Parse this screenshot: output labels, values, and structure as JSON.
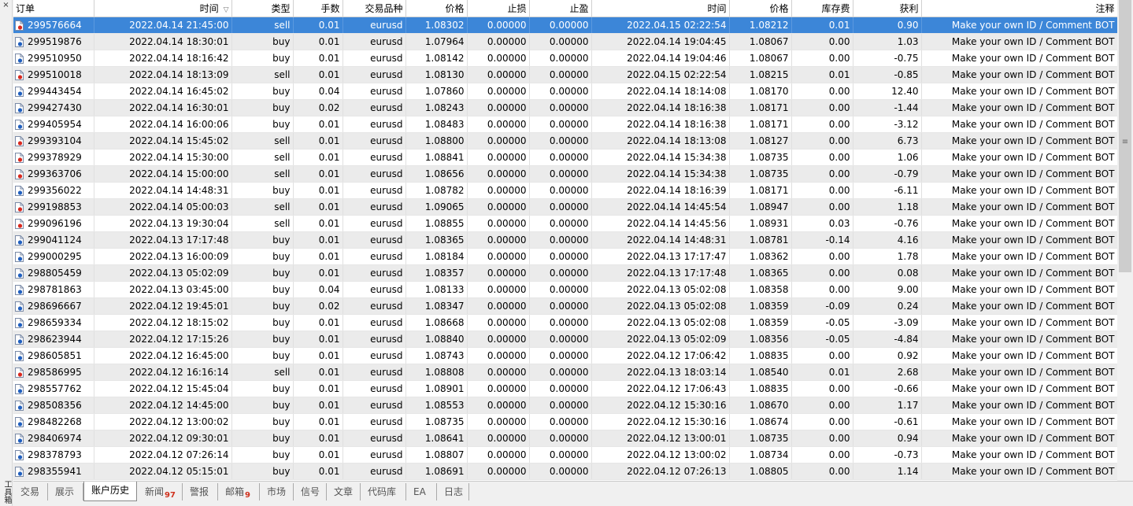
{
  "window": {
    "title": "工具箱",
    "close_label": "×"
  },
  "columns": [
    "订单",
    "时间",
    "类型",
    "手数",
    "交易品种",
    "价格",
    "止损",
    "止盈",
    "时间",
    "价格",
    "库存费",
    "获利",
    "注释"
  ],
  "sort_indicator": "▽",
  "rows": [
    {
      "id": "299576664",
      "open_time": "2022.04.14 21:45:00",
      "type": "sell",
      "lots": "0.01",
      "symbol": "eurusd",
      "open_price": "1.08302",
      "sl": "0.00000",
      "tp": "0.00000",
      "close_time": "2022.04.15 02:22:54",
      "close_price": "1.08212",
      "swap": "0.01",
      "profit": "0.90",
      "comment": "Make your own ID / Comment BOT"
    },
    {
      "id": "299519876",
      "open_time": "2022.04.14 18:30:01",
      "type": "buy",
      "lots": "0.01",
      "symbol": "eurusd",
      "open_price": "1.07964",
      "sl": "0.00000",
      "tp": "0.00000",
      "close_time": "2022.04.14 19:04:45",
      "close_price": "1.08067",
      "swap": "0.00",
      "profit": "1.03",
      "comment": "Make your own ID / Comment BOT"
    },
    {
      "id": "299510950",
      "open_time": "2022.04.14 18:16:42",
      "type": "buy",
      "lots": "0.01",
      "symbol": "eurusd",
      "open_price": "1.08142",
      "sl": "0.00000",
      "tp": "0.00000",
      "close_time": "2022.04.14 19:04:46",
      "close_price": "1.08067",
      "swap": "0.00",
      "profit": "-0.75",
      "comment": "Make your own ID / Comment BOT"
    },
    {
      "id": "299510018",
      "open_time": "2022.04.14 18:13:09",
      "type": "sell",
      "lots": "0.01",
      "symbol": "eurusd",
      "open_price": "1.08130",
      "sl": "0.00000",
      "tp": "0.00000",
      "close_time": "2022.04.15 02:22:54",
      "close_price": "1.08215",
      "swap": "0.01",
      "profit": "-0.85",
      "comment": "Make your own ID / Comment BOT"
    },
    {
      "id": "299443454",
      "open_time": "2022.04.14 16:45:02",
      "type": "buy",
      "lots": "0.04",
      "symbol": "eurusd",
      "open_price": "1.07860",
      "sl": "0.00000",
      "tp": "0.00000",
      "close_time": "2022.04.14 18:14:08",
      "close_price": "1.08170",
      "swap": "0.00",
      "profit": "12.40",
      "comment": "Make your own ID / Comment BOT"
    },
    {
      "id": "299427430",
      "open_time": "2022.04.14 16:30:01",
      "type": "buy",
      "lots": "0.02",
      "symbol": "eurusd",
      "open_price": "1.08243",
      "sl": "0.00000",
      "tp": "0.00000",
      "close_time": "2022.04.14 18:16:38",
      "close_price": "1.08171",
      "swap": "0.00",
      "profit": "-1.44",
      "comment": "Make your own ID / Comment BOT"
    },
    {
      "id": "299405954",
      "open_time": "2022.04.14 16:00:06",
      "type": "buy",
      "lots": "0.01",
      "symbol": "eurusd",
      "open_price": "1.08483",
      "sl": "0.00000",
      "tp": "0.00000",
      "close_time": "2022.04.14 18:16:38",
      "close_price": "1.08171",
      "swap": "0.00",
      "profit": "-3.12",
      "comment": "Make your own ID / Comment BOT"
    },
    {
      "id": "299393104",
      "open_time": "2022.04.14 15:45:02",
      "type": "sell",
      "lots": "0.01",
      "symbol": "eurusd",
      "open_price": "1.08800",
      "sl": "0.00000",
      "tp": "0.00000",
      "close_time": "2022.04.14 18:13:08",
      "close_price": "1.08127",
      "swap": "0.00",
      "profit": "6.73",
      "comment": "Make your own ID / Comment BOT"
    },
    {
      "id": "299378929",
      "open_time": "2022.04.14 15:30:00",
      "type": "sell",
      "lots": "0.01",
      "symbol": "eurusd",
      "open_price": "1.08841",
      "sl": "0.00000",
      "tp": "0.00000",
      "close_time": "2022.04.14 15:34:38",
      "close_price": "1.08735",
      "swap": "0.00",
      "profit": "1.06",
      "comment": "Make your own ID / Comment BOT"
    },
    {
      "id": "299363706",
      "open_time": "2022.04.14 15:00:00",
      "type": "sell",
      "lots": "0.01",
      "symbol": "eurusd",
      "open_price": "1.08656",
      "sl": "0.00000",
      "tp": "0.00000",
      "close_time": "2022.04.14 15:34:38",
      "close_price": "1.08735",
      "swap": "0.00",
      "profit": "-0.79",
      "comment": "Make your own ID / Comment BOT"
    },
    {
      "id": "299356022",
      "open_time": "2022.04.14 14:48:31",
      "type": "buy",
      "lots": "0.01",
      "symbol": "eurusd",
      "open_price": "1.08782",
      "sl": "0.00000",
      "tp": "0.00000",
      "close_time": "2022.04.14 18:16:39",
      "close_price": "1.08171",
      "swap": "0.00",
      "profit": "-6.11",
      "comment": "Make your own ID / Comment BOT"
    },
    {
      "id": "299198853",
      "open_time": "2022.04.14 05:00:03",
      "type": "sell",
      "lots": "0.01",
      "symbol": "eurusd",
      "open_price": "1.09065",
      "sl": "0.00000",
      "tp": "0.00000",
      "close_time": "2022.04.14 14:45:54",
      "close_price": "1.08947",
      "swap": "0.00",
      "profit": "1.18",
      "comment": "Make your own ID / Comment BOT"
    },
    {
      "id": "299096196",
      "open_time": "2022.04.13 19:30:04",
      "type": "sell",
      "lots": "0.01",
      "symbol": "eurusd",
      "open_price": "1.08855",
      "sl": "0.00000",
      "tp": "0.00000",
      "close_time": "2022.04.14 14:45:56",
      "close_price": "1.08931",
      "swap": "0.03",
      "profit": "-0.76",
      "comment": "Make your own ID / Comment BOT"
    },
    {
      "id": "299041124",
      "open_time": "2022.04.13 17:17:48",
      "type": "buy",
      "lots": "0.01",
      "symbol": "eurusd",
      "open_price": "1.08365",
      "sl": "0.00000",
      "tp": "0.00000",
      "close_time": "2022.04.14 14:48:31",
      "close_price": "1.08781",
      "swap": "-0.14",
      "profit": "4.16",
      "comment": "Make your own ID / Comment BOT"
    },
    {
      "id": "299000295",
      "open_time": "2022.04.13 16:00:09",
      "type": "buy",
      "lots": "0.01",
      "symbol": "eurusd",
      "open_price": "1.08184",
      "sl": "0.00000",
      "tp": "0.00000",
      "close_time": "2022.04.13 17:17:47",
      "close_price": "1.08362",
      "swap": "0.00",
      "profit": "1.78",
      "comment": "Make your own ID / Comment BOT"
    },
    {
      "id": "298805459",
      "open_time": "2022.04.13 05:02:09",
      "type": "buy",
      "lots": "0.01",
      "symbol": "eurusd",
      "open_price": "1.08357",
      "sl": "0.00000",
      "tp": "0.00000",
      "close_time": "2022.04.13 17:17:48",
      "close_price": "1.08365",
      "swap": "0.00",
      "profit": "0.08",
      "comment": "Make your own ID / Comment BOT"
    },
    {
      "id": "298781863",
      "open_time": "2022.04.13 03:45:00",
      "type": "buy",
      "lots": "0.04",
      "symbol": "eurusd",
      "open_price": "1.08133",
      "sl": "0.00000",
      "tp": "0.00000",
      "close_time": "2022.04.13 05:02:08",
      "close_price": "1.08358",
      "swap": "0.00",
      "profit": "9.00",
      "comment": "Make your own ID / Comment BOT"
    },
    {
      "id": "298696667",
      "open_time": "2022.04.12 19:45:01",
      "type": "buy",
      "lots": "0.02",
      "symbol": "eurusd",
      "open_price": "1.08347",
      "sl": "0.00000",
      "tp": "0.00000",
      "close_time": "2022.04.13 05:02:08",
      "close_price": "1.08359",
      "swap": "-0.09",
      "profit": "0.24",
      "comment": "Make your own ID / Comment BOT"
    },
    {
      "id": "298659334",
      "open_time": "2022.04.12 18:15:02",
      "type": "buy",
      "lots": "0.01",
      "symbol": "eurusd",
      "open_price": "1.08668",
      "sl": "0.00000",
      "tp": "0.00000",
      "close_time": "2022.04.13 05:02:08",
      "close_price": "1.08359",
      "swap": "-0.05",
      "profit": "-3.09",
      "comment": "Make your own ID / Comment BOT"
    },
    {
      "id": "298623944",
      "open_time": "2022.04.12 17:15:26",
      "type": "buy",
      "lots": "0.01",
      "symbol": "eurusd",
      "open_price": "1.08840",
      "sl": "0.00000",
      "tp": "0.00000",
      "close_time": "2022.04.13 05:02:09",
      "close_price": "1.08356",
      "swap": "-0.05",
      "profit": "-4.84",
      "comment": "Make your own ID / Comment BOT"
    },
    {
      "id": "298605851",
      "open_time": "2022.04.12 16:45:00",
      "type": "buy",
      "lots": "0.01",
      "symbol": "eurusd",
      "open_price": "1.08743",
      "sl": "0.00000",
      "tp": "0.00000",
      "close_time": "2022.04.12 17:06:42",
      "close_price": "1.08835",
      "swap": "0.00",
      "profit": "0.92",
      "comment": "Make your own ID / Comment BOT"
    },
    {
      "id": "298586995",
      "open_time": "2022.04.12 16:16:14",
      "type": "sell",
      "lots": "0.01",
      "symbol": "eurusd",
      "open_price": "1.08808",
      "sl": "0.00000",
      "tp": "0.00000",
      "close_time": "2022.04.13 18:03:14",
      "close_price": "1.08540",
      "swap": "0.01",
      "profit": "2.68",
      "comment": "Make your own ID / Comment BOT"
    },
    {
      "id": "298557762",
      "open_time": "2022.04.12 15:45:04",
      "type": "buy",
      "lots": "0.01",
      "symbol": "eurusd",
      "open_price": "1.08901",
      "sl": "0.00000",
      "tp": "0.00000",
      "close_time": "2022.04.12 17:06:43",
      "close_price": "1.08835",
      "swap": "0.00",
      "profit": "-0.66",
      "comment": "Make your own ID / Comment BOT"
    },
    {
      "id": "298508356",
      "open_time": "2022.04.12 14:45:00",
      "type": "buy",
      "lots": "0.01",
      "symbol": "eurusd",
      "open_price": "1.08553",
      "sl": "0.00000",
      "tp": "0.00000",
      "close_time": "2022.04.12 15:30:16",
      "close_price": "1.08670",
      "swap": "0.00",
      "profit": "1.17",
      "comment": "Make your own ID / Comment BOT"
    },
    {
      "id": "298482268",
      "open_time": "2022.04.12 13:00:02",
      "type": "buy",
      "lots": "0.01",
      "symbol": "eurusd",
      "open_price": "1.08735",
      "sl": "0.00000",
      "tp": "0.00000",
      "close_time": "2022.04.12 15:30:16",
      "close_price": "1.08674",
      "swap": "0.00",
      "profit": "-0.61",
      "comment": "Make your own ID / Comment BOT"
    },
    {
      "id": "298406974",
      "open_time": "2022.04.12 09:30:01",
      "type": "buy",
      "lots": "0.01",
      "symbol": "eurusd",
      "open_price": "1.08641",
      "sl": "0.00000",
      "tp": "0.00000",
      "close_time": "2022.04.12 13:00:01",
      "close_price": "1.08735",
      "swap": "0.00",
      "profit": "0.94",
      "comment": "Make your own ID / Comment BOT"
    },
    {
      "id": "298378793",
      "open_time": "2022.04.12 07:26:14",
      "type": "buy",
      "lots": "0.01",
      "symbol": "eurusd",
      "open_price": "1.08807",
      "sl": "0.00000",
      "tp": "0.00000",
      "close_time": "2022.04.12 13:00:02",
      "close_price": "1.08734",
      "swap": "0.00",
      "profit": "-0.73",
      "comment": "Make your own ID / Comment BOT"
    },
    {
      "id": "298355941",
      "open_time": "2022.04.12 05:15:01",
      "type": "buy",
      "lots": "0.01",
      "symbol": "eurusd",
      "open_price": "1.08691",
      "sl": "0.00000",
      "tp": "0.00000",
      "close_time": "2022.04.12 07:26:13",
      "close_price": "1.08805",
      "swap": "0.00",
      "profit": "1.14",
      "comment": "Make your own ID / Comment BOT"
    }
  ],
  "scrollbar": {
    "grip": "≡"
  },
  "tabs": [
    {
      "label": "交易",
      "badge": ""
    },
    {
      "label": "展示",
      "badge": ""
    },
    {
      "label": "账户历史",
      "badge": "",
      "active": true
    },
    {
      "label": "新闻",
      "badge": "97"
    },
    {
      "label": "警报",
      "badge": ""
    },
    {
      "label": "邮箱",
      "badge": "9"
    },
    {
      "label": "市场",
      "badge": ""
    },
    {
      "label": "信号",
      "badge": ""
    },
    {
      "label": "文章",
      "badge": ""
    },
    {
      "label": "代码库",
      "badge": ""
    },
    {
      "label": "EA",
      "badge": ""
    },
    {
      "label": "日志",
      "badge": ""
    }
  ],
  "colors": {
    "selected_row": "#3c86d8",
    "buy_icon": "#1f5fbf",
    "sell_icon": "#d8281e",
    "badge": "#d0311d"
  }
}
